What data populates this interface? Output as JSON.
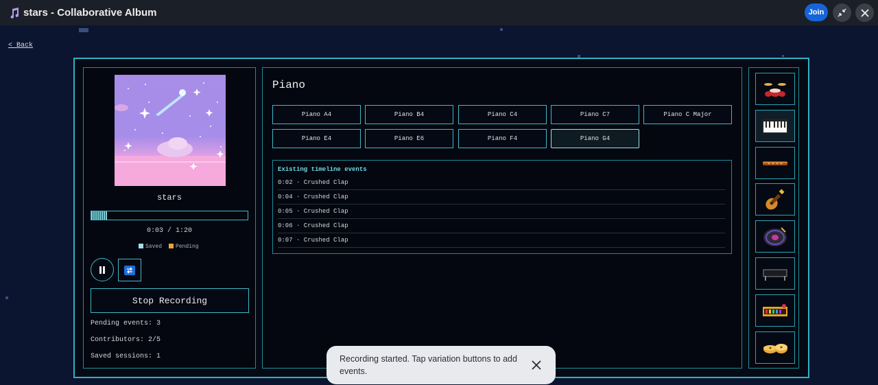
{
  "window": {
    "title": "stars - Collaborative Album",
    "join_label": "Join",
    "icons": [
      "music-note-icon",
      "collapse-icon",
      "close-icon"
    ]
  },
  "nav": {
    "back_label": "< Back"
  },
  "player": {
    "album_name": "stars",
    "time": "0:03 / 1:20",
    "progress_fraction": 0.1,
    "legend": {
      "saved": "Saved",
      "pending": "Pending"
    },
    "colors": {
      "saved": "#a8dbe6",
      "pending": "#e8a43a",
      "accent": "#2fb3c4"
    },
    "stop_label": "Stop Recording",
    "stats": {
      "pending": "Pending events: 3",
      "contributors": "Contributors: 2/5",
      "saved_sessions": "Saved sessions: 1"
    }
  },
  "instrument": {
    "title": "Piano",
    "variations": [
      "Piano A4",
      "Piano B4",
      "Piano C4",
      "Piano C7",
      "Piano C Major",
      "Piano E4",
      "Piano E6",
      "Piano F4",
      "Piano G4"
    ],
    "selected_variation": "Piano G4"
  },
  "timeline": {
    "title": "Existing timeline events",
    "events": [
      "0:02 · Crushed Clap",
      "0:04 · Crushed Clap",
      "0:05 · Crushed Clap",
      "0:06 · Crushed Clap",
      "0:07 · Crushed Clap"
    ]
  },
  "instruments_sidebar": [
    "drum-kit-icon",
    "piano-keyboard-icon",
    "flute-icon",
    "guitar-icon",
    "vinyl-record-icon",
    "synth-icon",
    "xylophone-icon",
    "cymbals-icon"
  ],
  "toast": {
    "message": "Recording started. Tap variation buttons to add events."
  }
}
